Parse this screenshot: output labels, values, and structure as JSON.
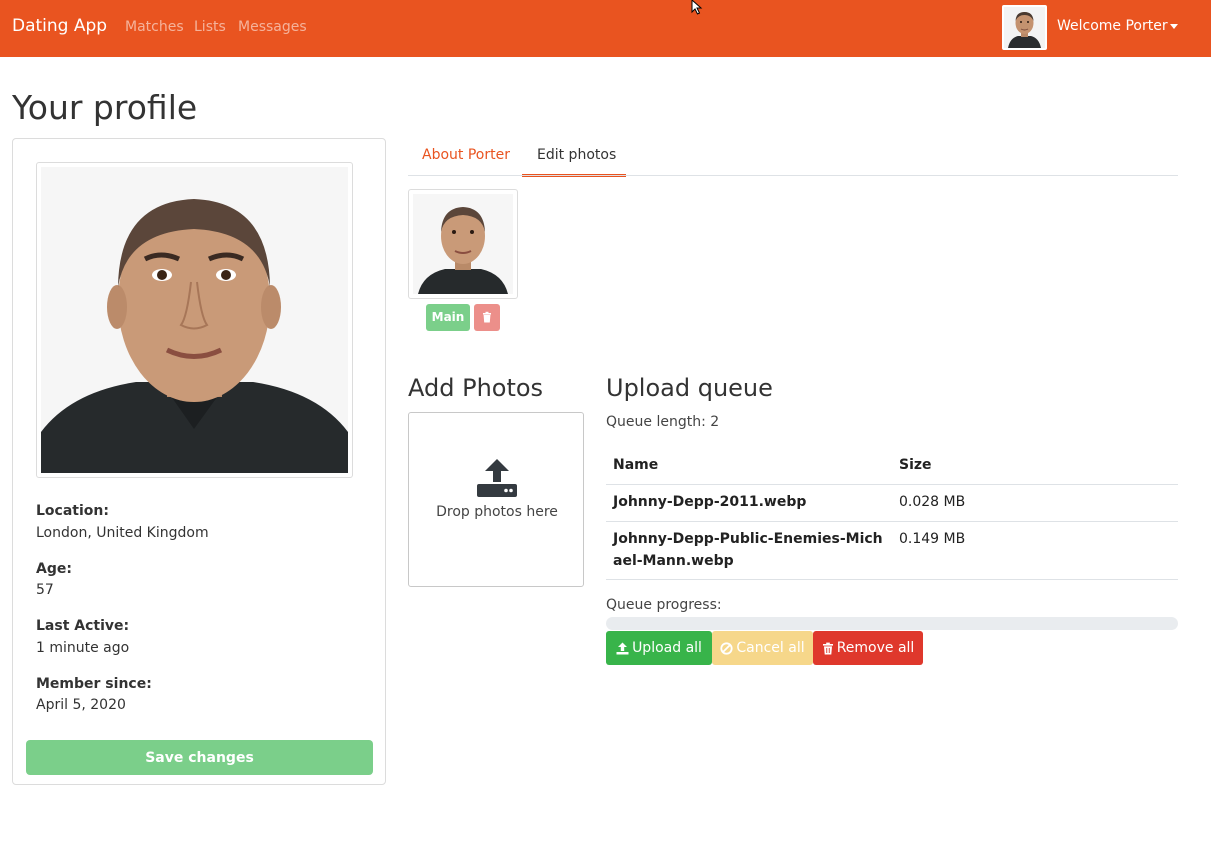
{
  "navbar": {
    "brand": "Dating App",
    "links": [
      "Matches",
      "Lists",
      "Messages"
    ],
    "welcome": "Welcome Porter",
    "color": "#e95420"
  },
  "page": {
    "title": "Your profile"
  },
  "profile": {
    "fields": [
      {
        "label": "Location:",
        "value": "London, United Kingdom"
      },
      {
        "label": "Age:",
        "value": "57"
      },
      {
        "label": "Last Active:",
        "value": "1 minute ago"
      },
      {
        "label": "Member since:",
        "value": "April 5, 2020"
      }
    ],
    "save_label": "Save changes"
  },
  "tabs": [
    {
      "label": "About Porter",
      "active": false
    },
    {
      "label": "Edit photos",
      "active": true
    }
  ],
  "photo": {
    "main_label": "Main",
    "delete_icon": "trash-icon"
  },
  "add_photos": {
    "heading": "Add Photos",
    "drop_text": "Drop photos here",
    "icon": "upload-icon"
  },
  "queue": {
    "heading": "Upload queue",
    "length_text": "Queue length: 2",
    "columns": [
      "Name",
      "Size"
    ],
    "rows": [
      {
        "name": "Johnny-Depp-2011.webp",
        "size": "0.028 MB"
      },
      {
        "name": "Johnny-Depp-Public-Enemies-Michael-Mann.webp",
        "size": "0.149 MB"
      }
    ],
    "progress_label": "Queue progress:",
    "progress_value": 0,
    "buttons": {
      "upload": "Upload all",
      "cancel": "Cancel all",
      "remove": "Remove all"
    }
  }
}
